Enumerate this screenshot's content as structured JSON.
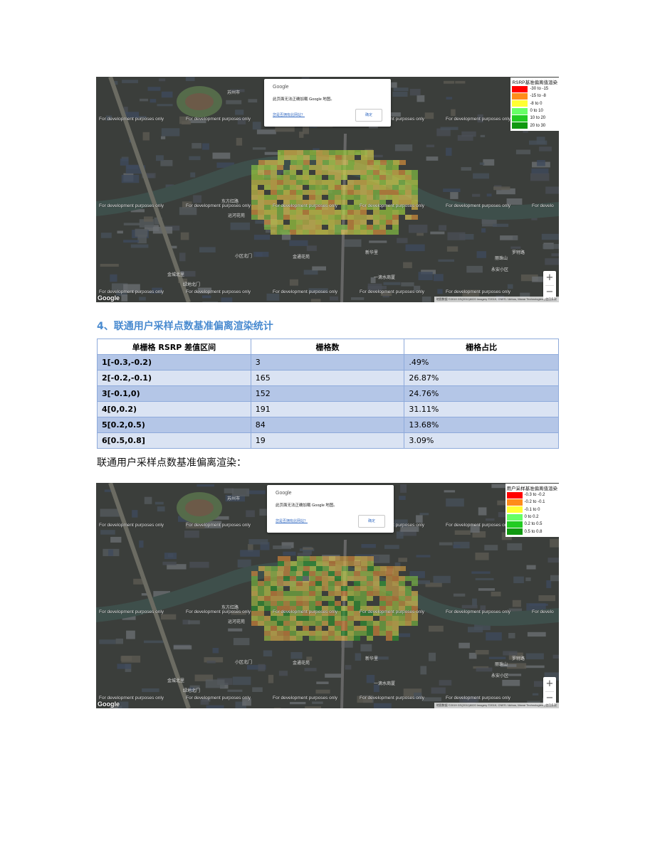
{
  "section_heading": "4、联通用户采样点数基准偏离渲染统计",
  "caption": "联通用户采样点数基准偏离渲染：",
  "maps": [
    {
      "dialog": {
        "google_label": "Google",
        "message": "此页面无法正确加载 Google 地图。",
        "link": "您是否拥有此网站？",
        "ok_button": "确定"
      },
      "dev_label": "For development purposes only",
      "logo": "Google",
      "attribution": "地图数据 ©2019 GS(2011)6020 Imagery ©2019, CNES / Airbus, Maxar Technologies | 使用条款",
      "zoom_in": "+",
      "zoom_out": "−",
      "legend": {
        "title": "RSRP基准偏离值渲染",
        "items": [
          {
            "label": "-30  to  -15",
            "color": "#ff0000"
          },
          {
            "label": "-15  to   -8",
            "color": "#ff8c1a"
          },
          {
            "label": "-8  to    0",
            "color": "#ffff33"
          },
          {
            "label": "0  to   10",
            "color": "#66ff66"
          },
          {
            "label": "10  to   20",
            "color": "#22cc22"
          },
          {
            "label": "20  to   30",
            "color": "#119911"
          }
        ]
      }
    },
    {
      "dialog": {
        "google_label": "Google",
        "message": "此页面无法正确加载 Google 地图。",
        "link": "您是否拥有此网站？",
        "ok_button": "确定"
      },
      "dev_label": "For development purposes only",
      "logo": "Google",
      "attribution": "地图数据 ©2019 GS(2011)6020 Imagery ©2019, CNES / Airbus, Maxar Technologies | 使用条款",
      "zoom_in": "+",
      "zoom_out": "−",
      "legend": {
        "title": "用户采样基准偏离值渲染",
        "items": [
          {
            "label": "-0.3 to -0.2",
            "color": "#ff0000"
          },
          {
            "label": "-0.2 to -0.1",
            "color": "#ff8c1a"
          },
          {
            "label": "-0.1 to  0",
            "color": "#ffff33"
          },
          {
            "label": "0    to  0.2",
            "color": "#66ff66"
          },
          {
            "label": "0.2 to  0.5",
            "color": "#22cc22"
          },
          {
            "label": "0.5 to  0.8",
            "color": "#119911"
          }
        ]
      }
    }
  ],
  "map_labels": [
    "苏州市",
    "东方红路",
    "运河花苑",
    "小区北门",
    "金通花苑",
    "新华里",
    "一滴水商厦",
    "永安小区",
    "金城北里",
    "绿地北门",
    "丽珠山",
    "罗特路"
  ],
  "table": {
    "headers": [
      "单栅格 RSRP 差值区间",
      "栅格数",
      "栅格占比"
    ],
    "rows": [
      [
        "1[-0.3,-0.2)",
        "3",
        ".49%"
      ],
      [
        "2[-0.2,-0.1)",
        "165",
        "26.87%"
      ],
      [
        "3[-0.1,0)",
        "152",
        "24.76%"
      ],
      [
        "4[0,0.2)",
        "191",
        "31.11%"
      ],
      [
        "5[0.2,0.5)",
        "84",
        "13.68%"
      ],
      [
        "6[0.5,0.8]",
        "19",
        "3.09%"
      ]
    ]
  }
}
